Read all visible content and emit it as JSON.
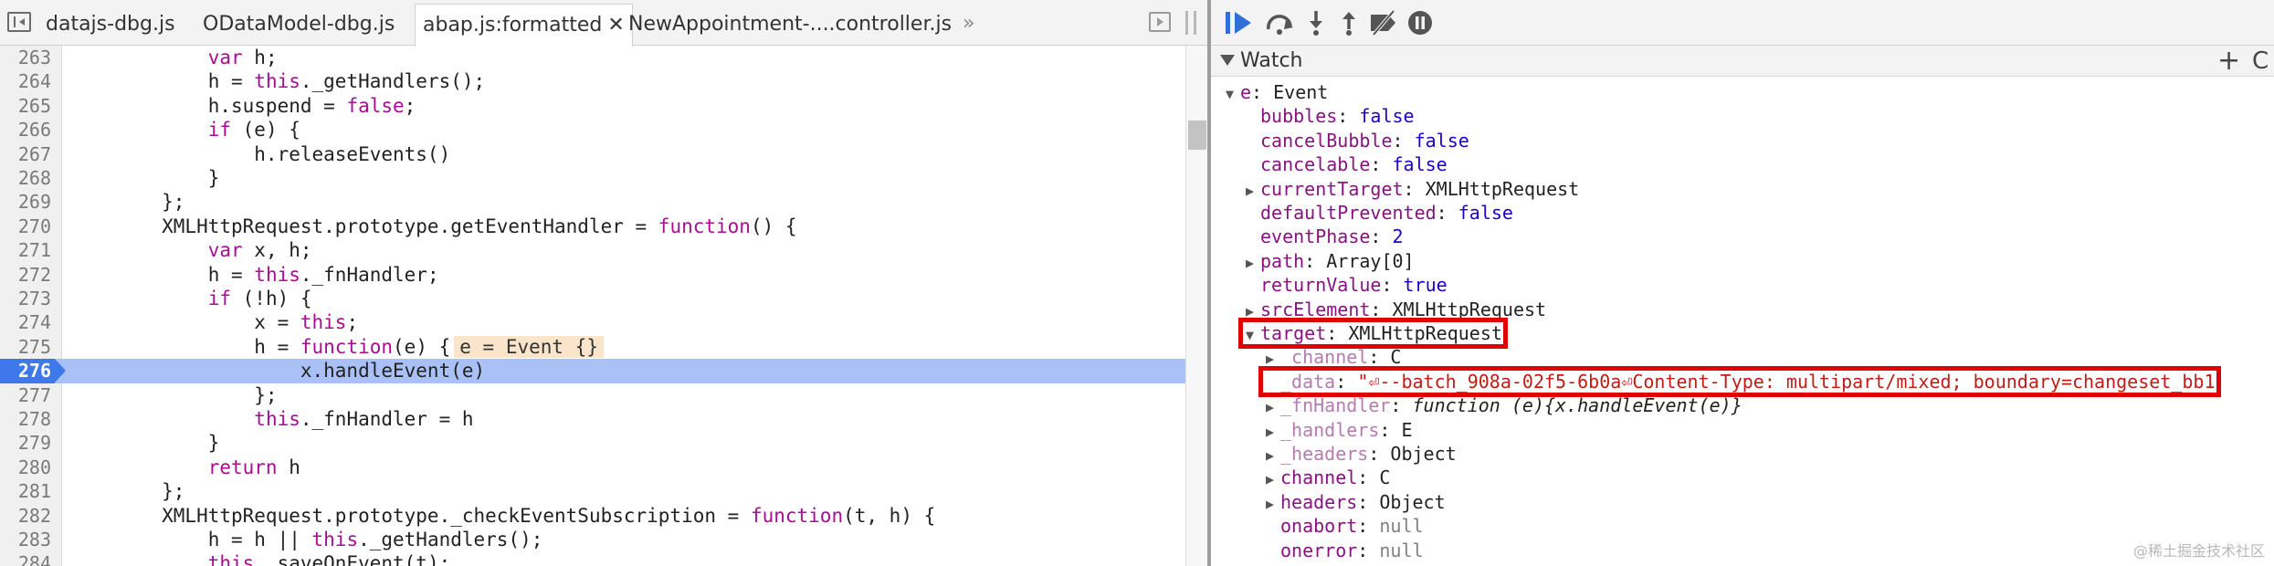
{
  "tabs": [
    {
      "label": "datajs-dbg.js",
      "active": false,
      "close": ""
    },
    {
      "label": "ODataModel-dbg.js",
      "active": false,
      "close": ""
    },
    {
      "label": "abap.js:formatted",
      "active": true,
      "close": "✕"
    },
    {
      "label": "NewAppointment-....controller.js",
      "active": false,
      "close": ""
    }
  ],
  "tab_overflow": "»",
  "current_line": 276,
  "code": [
    {
      "n": "263",
      "parts": [
        {
          "t": "            "
        },
        {
          "t": "var",
          "k": true
        },
        {
          "t": " h;"
        }
      ]
    },
    {
      "n": "264",
      "parts": [
        {
          "t": "            h = "
        },
        {
          "t": "this",
          "k": true
        },
        {
          "t": "._getHandlers();"
        }
      ]
    },
    {
      "n": "265",
      "parts": [
        {
          "t": "            h.suspend = "
        },
        {
          "t": "false",
          "k": true
        },
        {
          "t": ";"
        }
      ]
    },
    {
      "n": "266",
      "parts": [
        {
          "t": "            "
        },
        {
          "t": "if",
          "k": true
        },
        {
          "t": " (e) {"
        }
      ]
    },
    {
      "n": "267",
      "parts": [
        {
          "t": "                h.releaseEvents()"
        }
      ]
    },
    {
      "n": "268",
      "parts": [
        {
          "t": "            }"
        }
      ]
    },
    {
      "n": "269",
      "parts": [
        {
          "t": "        };"
        }
      ]
    },
    {
      "n": "270",
      "parts": [
        {
          "t": "        XMLHttpRequest.prototype.getEventHandler = "
        },
        {
          "t": "function",
          "k": true
        },
        {
          "t": "() {"
        }
      ]
    },
    {
      "n": "271",
      "parts": [
        {
          "t": "            "
        },
        {
          "t": "var",
          "k": true
        },
        {
          "t": " x, h;"
        }
      ]
    },
    {
      "n": "272",
      "parts": [
        {
          "t": "            h = "
        },
        {
          "t": "this",
          "k": true
        },
        {
          "t": "._fnHandler;"
        }
      ]
    },
    {
      "n": "273",
      "parts": [
        {
          "t": "            "
        },
        {
          "t": "if",
          "k": true
        },
        {
          "t": " (!h) {"
        }
      ]
    },
    {
      "n": "274",
      "parts": [
        {
          "t": "                x = "
        },
        {
          "t": "this",
          "k": true
        },
        {
          "t": ";"
        }
      ]
    },
    {
      "n": "275",
      "parts": [
        {
          "t": "                h = "
        },
        {
          "t": "function",
          "k": true
        },
        {
          "t": "(e) {"
        }
      ],
      "inline": "e = Event {}"
    },
    {
      "n": "276",
      "parts": [
        {
          "t": "                    x.handleEvent(e)"
        }
      ]
    },
    {
      "n": "277",
      "parts": [
        {
          "t": "                };"
        }
      ]
    },
    {
      "n": "278",
      "parts": [
        {
          "t": "                "
        },
        {
          "t": "this",
          "k": true
        },
        {
          "t": "._fnHandler = h"
        }
      ]
    },
    {
      "n": "279",
      "parts": [
        {
          "t": "            }"
        }
      ]
    },
    {
      "n": "280",
      "parts": [
        {
          "t": "            "
        },
        {
          "t": "return",
          "k": true
        },
        {
          "t": " h"
        }
      ]
    },
    {
      "n": "281",
      "parts": [
        {
          "t": "        };"
        }
      ]
    },
    {
      "n": "282",
      "parts": [
        {
          "t": "        XMLHttpRequest.prototype._checkEventSubscription = "
        },
        {
          "t": "function",
          "k": true
        },
        {
          "t": "(t, h) {"
        }
      ]
    },
    {
      "n": "283",
      "parts": [
        {
          "t": "            h = h || "
        },
        {
          "t": "this",
          "k": true
        },
        {
          "t": "._getHandlers();"
        }
      ]
    },
    {
      "n": "284",
      "parts": [
        {
          "t": "            "
        },
        {
          "t": "this",
          "k": true
        },
        {
          "t": "._saveOnEvent(t);"
        }
      ]
    }
  ],
  "watch": {
    "title": "Watch",
    "add_label": "+",
    "refresh_label": "C",
    "rows": [
      {
        "indent": 0,
        "tri": "▼",
        "name": "e",
        "sep": ": ",
        "value": "Event",
        "vtype": "obj",
        "dim": false
      },
      {
        "indent": 1,
        "tri": "",
        "name": "bubbles",
        "sep": ": ",
        "value": "false",
        "vtype": "bool",
        "dim": false
      },
      {
        "indent": 1,
        "tri": "",
        "name": "cancelBubble",
        "sep": ": ",
        "value": "false",
        "vtype": "bool",
        "dim": false
      },
      {
        "indent": 1,
        "tri": "",
        "name": "cancelable",
        "sep": ": ",
        "value": "false",
        "vtype": "bool",
        "dim": false
      },
      {
        "indent": 1,
        "tri": "▶",
        "name": "currentTarget",
        "sep": ": ",
        "value": "XMLHttpRequest",
        "vtype": "obj",
        "dim": false
      },
      {
        "indent": 1,
        "tri": "",
        "name": "defaultPrevented",
        "sep": ": ",
        "value": "false",
        "vtype": "bool",
        "dim": false
      },
      {
        "indent": 1,
        "tri": "",
        "name": "eventPhase",
        "sep": ": ",
        "value": "2",
        "vtype": "num",
        "dim": false
      },
      {
        "indent": 1,
        "tri": "▶",
        "name": "path",
        "sep": ": ",
        "value": "Array[0]",
        "vtype": "obj",
        "dim": false
      },
      {
        "indent": 1,
        "tri": "",
        "name": "returnValue",
        "sep": ": ",
        "value": "true",
        "vtype": "bool",
        "dim": false
      },
      {
        "indent": 1,
        "tri": "▶",
        "name": "srcElement",
        "sep": ": ",
        "value": "XMLHttpRequest",
        "vtype": "obj",
        "dim": false
      },
      {
        "indent": 1,
        "tri": "▼",
        "name": "target",
        "sep": ": ",
        "value": "XMLHttpRequest",
        "vtype": "obj",
        "dim": false
      },
      {
        "indent": 2,
        "tri": "▶",
        "name": "_channel",
        "sep": ": ",
        "value": "C",
        "vtype": "obj",
        "dim": true
      },
      {
        "indent": 2,
        "tri": "",
        "name": "_data",
        "sep": ": ",
        "value": "\"⏎--batch_908a-02f5-6b0a⏎Content-Type: multipart/mixed; boundary=changeset_bb1",
        "vtype": "str",
        "dim": true
      },
      {
        "indent": 2,
        "tri": "▶",
        "name": "_fnHandler",
        "sep": ": ",
        "value": "function (e){x.handleEvent(e)}",
        "vtype": "fn",
        "dim": true
      },
      {
        "indent": 2,
        "tri": "▶",
        "name": "_handlers",
        "sep": ": ",
        "value": "E",
        "vtype": "obj",
        "dim": true
      },
      {
        "indent": 2,
        "tri": "▶",
        "name": "_headers",
        "sep": ": ",
        "value": "Object",
        "vtype": "obj",
        "dim": true
      },
      {
        "indent": 2,
        "tri": "▶",
        "name": "channel",
        "sep": ": ",
        "value": "C",
        "vtype": "obj",
        "dim": false
      },
      {
        "indent": 2,
        "tri": "▶",
        "name": "headers",
        "sep": ": ",
        "value": "Object",
        "vtype": "obj",
        "dim": false
      },
      {
        "indent": 2,
        "tri": "",
        "name": "onabort",
        "sep": ": ",
        "value": "null",
        "vtype": "null",
        "dim": false
      },
      {
        "indent": 2,
        "tri": "",
        "name": "onerror",
        "sep": ": ",
        "value": "null",
        "vtype": "null",
        "dim": false
      }
    ],
    "highlighted": [
      "target",
      "_data"
    ]
  },
  "watermark": "@稀土掘金技术社区",
  "colors": {
    "keyword": "#aa0d91",
    "property": "#881280",
    "value_bool": "#1c00cf",
    "value_string": "#c41a16",
    "current_line": "#a9c1f7",
    "line_marker": "#3f78ea",
    "highlight_box": "#e00000"
  }
}
